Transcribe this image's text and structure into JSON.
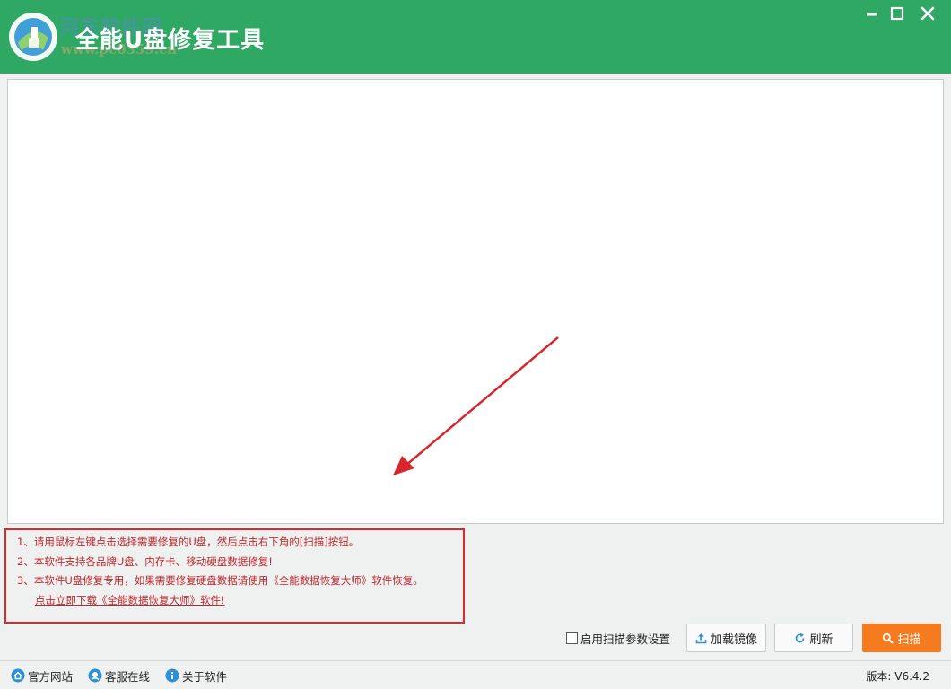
{
  "titlebar": {
    "app_title": "全能U盘修复工具",
    "watermark_text": "河东软件园",
    "watermark_url": "www.pc0359.cn",
    "minimize_icon": "minimize-icon",
    "maximize_icon": "maximize-icon",
    "close_icon": "close-icon"
  },
  "notes": {
    "line1": "1、请用鼠标左键点击选择需要修复的U盘，然后点击右下角的[扫描]按钮。",
    "line2": "2、本软件支持各品牌U盘、内存卡、移动硬盘数据修复!",
    "line3": "3、本软件U盘修复专用，如果需要修复硬盘数据请使用《全能数据恢复大师》软件恢复。",
    "download_link": "点击立即下载《全能数据恢复大师》软件!"
  },
  "controls": {
    "scan_params_label": "启用扫描参数设置",
    "scan_params_checked": false,
    "load_image_label": "加载镜像",
    "refresh_label": "刷新",
    "scan_label": "扫描"
  },
  "footer": {
    "official_site": "官方网站",
    "online_service": "客服在线",
    "about": "关于软件",
    "version": "版本: V6.4.2"
  },
  "colors": {
    "titlebar": "#2fa863",
    "scan_button": "#f67b1f",
    "note_text": "#c0282d",
    "highlight_border": "#e0282f"
  }
}
